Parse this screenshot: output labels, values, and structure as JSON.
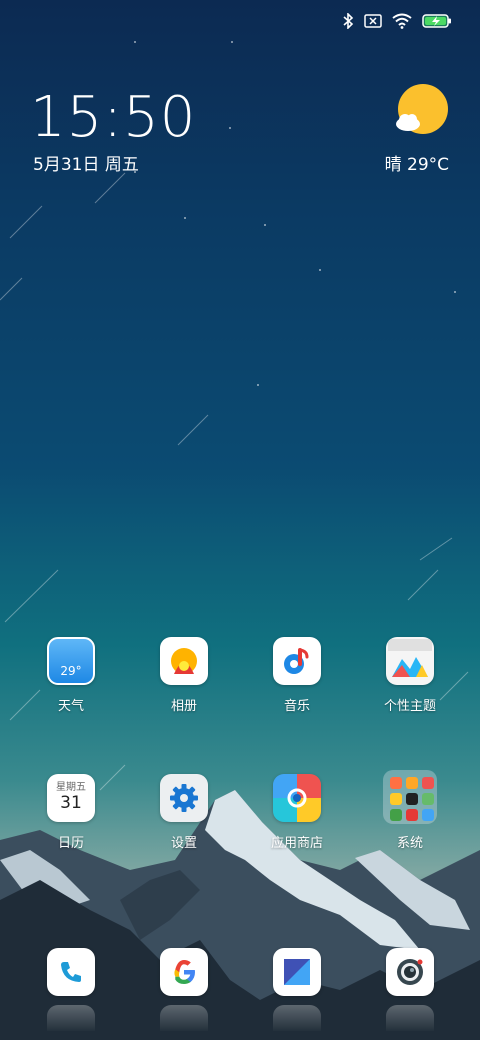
{
  "status_bar": {
    "icons": [
      "bluetooth-icon",
      "no-sim-icon",
      "wifi-icon",
      "battery-charging-icon"
    ]
  },
  "lockscreen_widget": {
    "time": "15:50",
    "date": "5月31日 周五",
    "weather": "晴  29°C",
    "weather_icon": "sun-cloud-icon"
  },
  "home_apps": [
    {
      "label": "天气",
      "icon": "weather-icon",
      "badge": "29°"
    },
    {
      "label": "相册",
      "icon": "gallery-icon"
    },
    {
      "label": "音乐",
      "icon": "music-icon"
    },
    {
      "label": "个性主题",
      "icon": "themes-icon"
    },
    {
      "label": "日历",
      "icon": "calendar-icon",
      "weekday": "星期五",
      "day": "31"
    },
    {
      "label": "设置",
      "icon": "settings-gear-icon"
    },
    {
      "label": "应用商店",
      "icon": "app-store-icon"
    },
    {
      "label": "系统",
      "icon": "folder-icon"
    }
  ],
  "dock": [
    {
      "icon": "phone-icon"
    },
    {
      "icon": "google-icon",
      "text": "G"
    },
    {
      "icon": "messages-icon"
    },
    {
      "icon": "camera-icon"
    }
  ],
  "colors": {
    "accent_blue": "#1e88e5",
    "google_red": "#ea4335",
    "sun_yellow": "#fbc02d"
  }
}
